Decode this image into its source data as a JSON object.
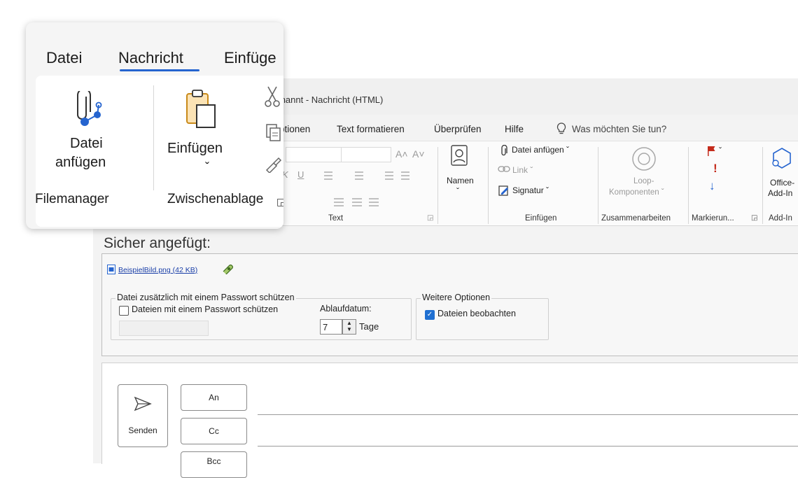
{
  "window": {
    "title": "Unbenannt - Nachricht (HTML)",
    "title_visible": "nbenannt - Nachricht (HTML)"
  },
  "menu": {
    "items": [
      "ptionen",
      "Text formatieren",
      "Überprüfen",
      "Hilfe"
    ],
    "tell_me": "Was möchten Sie tun?"
  },
  "ribbon": {
    "text_group_label": "Text",
    "names_label": "Namen",
    "names_chevron": "ˇ",
    "attach_label": "Datei anfügen ˇ",
    "link_label": "Link ˇ",
    "signature_label": "Signatur ˇ",
    "insert_group_label": "Einfügen",
    "loop_label1": "Loop-",
    "loop_label2": "Komponenten ˇ",
    "collab_group_label": "Zusammenarbeiten",
    "flag_chevron": "ˇ",
    "flag_group_label": "Markierun...",
    "office_label1": "Office-",
    "office_label2": "Add-In",
    "addin_group_label": "Add-In",
    "font_grow": "A˄",
    "font_shrink": "A˅",
    "italic": "K",
    "underline": "U"
  },
  "attach": {
    "heading": "Sicher angefügt:",
    "file": "BeispielBild.png (42 KB)",
    "password_legend": "Datei zusätzlich mit einem Passwort schützen",
    "password_checkbox": "Dateien mit einem Passwort schützen",
    "expiry_label": "Ablaufdatum:",
    "expiry_value": "7",
    "expiry_unit": "Tage",
    "more_legend": "Weitere Optionen",
    "watch_checkbox": "Dateien beobachten",
    "watch_checked": true
  },
  "compose": {
    "send": "Senden",
    "to": "An",
    "cc": "Cc",
    "bcc": "Bcc"
  },
  "callout": {
    "tabs": [
      "Datei",
      "Nachricht",
      "Einfüge"
    ],
    "attach_line1": "Datei",
    "attach_line2": "anfügen",
    "paste_label": "Einfügen",
    "chevron": "ˇ",
    "group1": "Filemanager",
    "group2": "Zwischenablage",
    "accent": "#2564cf"
  }
}
